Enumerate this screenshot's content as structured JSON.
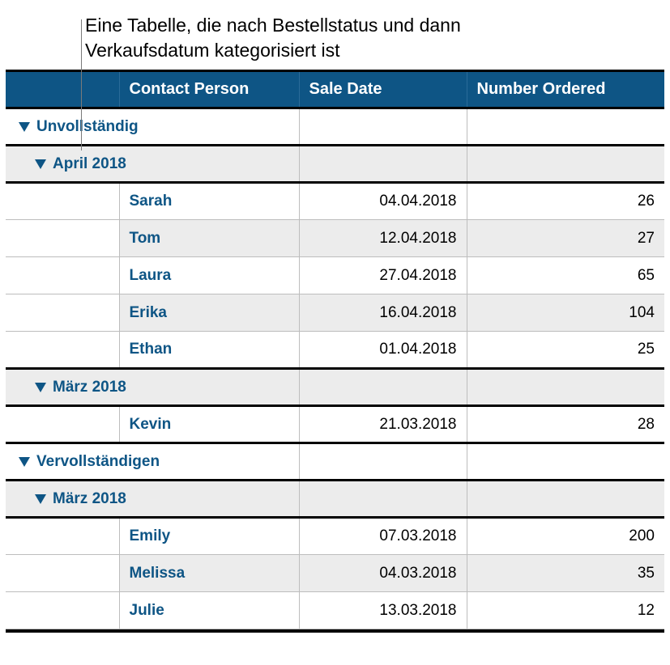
{
  "caption": "Eine Tabelle, die nach Bestellstatus und dann Verkaufsdatum kategorisiert ist",
  "columns": {
    "contact_person": "Contact Person",
    "sale_date": "Sale Date",
    "number_ordered": "Number Ordered"
  },
  "groups": [
    {
      "label": "Unvollständig",
      "subgroups": [
        {
          "label": "April 2018",
          "rows": [
            {
              "contact": "Sarah",
              "date": "04.04.2018",
              "num": "26"
            },
            {
              "contact": "Tom",
              "date": "12.04.2018",
              "num": "27"
            },
            {
              "contact": "Laura",
              "date": "27.04.2018",
              "num": "65"
            },
            {
              "contact": "Erika",
              "date": "16.04.2018",
              "num": "104"
            },
            {
              "contact": "Ethan",
              "date": "01.04.2018",
              "num": "25"
            }
          ]
        },
        {
          "label": "März 2018",
          "rows": [
            {
              "contact": "Kevin",
              "date": "21.03.2018",
              "num": "28"
            }
          ]
        }
      ]
    },
    {
      "label": "Vervollständigen",
      "subgroups": [
        {
          "label": "März 2018",
          "rows": [
            {
              "contact": "Emily",
              "date": "07.03.2018",
              "num": "200"
            },
            {
              "contact": "Melissa",
              "date": "04.03.2018",
              "num": "35"
            },
            {
              "contact": "Julie",
              "date": "13.03.2018",
              "num": "12"
            }
          ]
        }
      ]
    }
  ]
}
